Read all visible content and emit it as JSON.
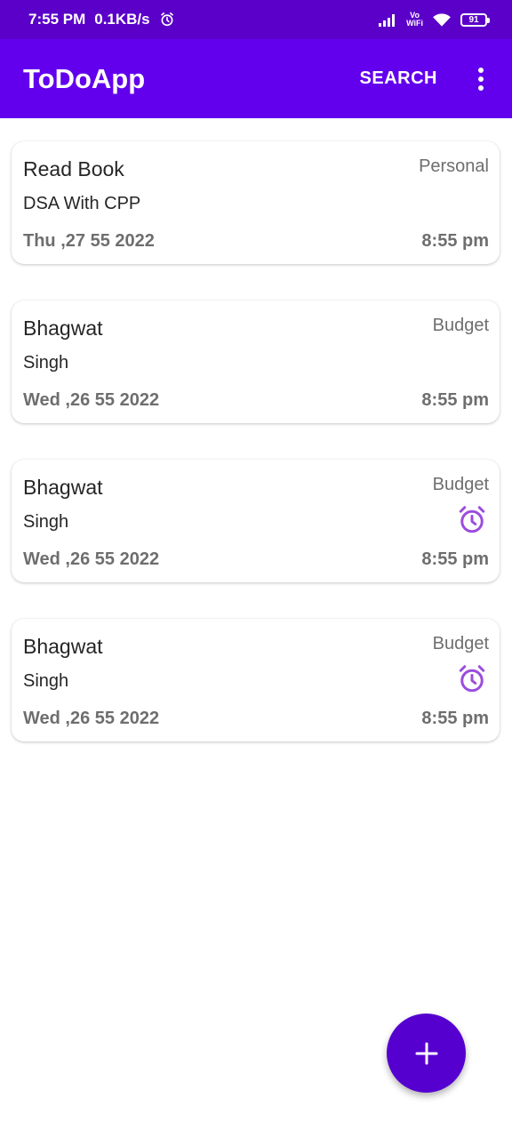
{
  "status_bar": {
    "time": "7:55 PM",
    "speed": "0.1KB/s",
    "vowifi_top": "Vo",
    "vowifi_bottom": "WiFi",
    "battery": "91"
  },
  "app_bar": {
    "title": "ToDoApp",
    "search_label": "SEARCH",
    "menu_icon": "more-vert-icon"
  },
  "tasks": [
    {
      "title": "Read Book",
      "category": "Personal",
      "description": "DSA With CPP",
      "date": "Thu ,27 55 2022",
      "time": "8:55 pm",
      "has_alarm": false
    },
    {
      "title": "Bhagwat",
      "category": "Budget",
      "description": "Singh",
      "date": "Wed ,26 55 2022",
      "time": "8:55 pm",
      "has_alarm": false
    },
    {
      "title": "Bhagwat",
      "category": "Budget",
      "description": "Singh",
      "date": "Wed ,26 55 2022",
      "time": "8:55 pm",
      "has_alarm": true
    },
    {
      "title": "Bhagwat",
      "category": "Budget",
      "description": "Singh",
      "date": "Wed ,26 55 2022",
      "time": "8:55 pm",
      "has_alarm": true
    }
  ],
  "fab": {
    "icon": "plus-icon"
  },
  "colors": {
    "status_bar": "#5a00c8",
    "app_bar": "#6200ee",
    "fab": "#5600d0",
    "alarm": "#9b4dde",
    "muted_text": "#6e6e6e",
    "primary_text": "#262626"
  }
}
